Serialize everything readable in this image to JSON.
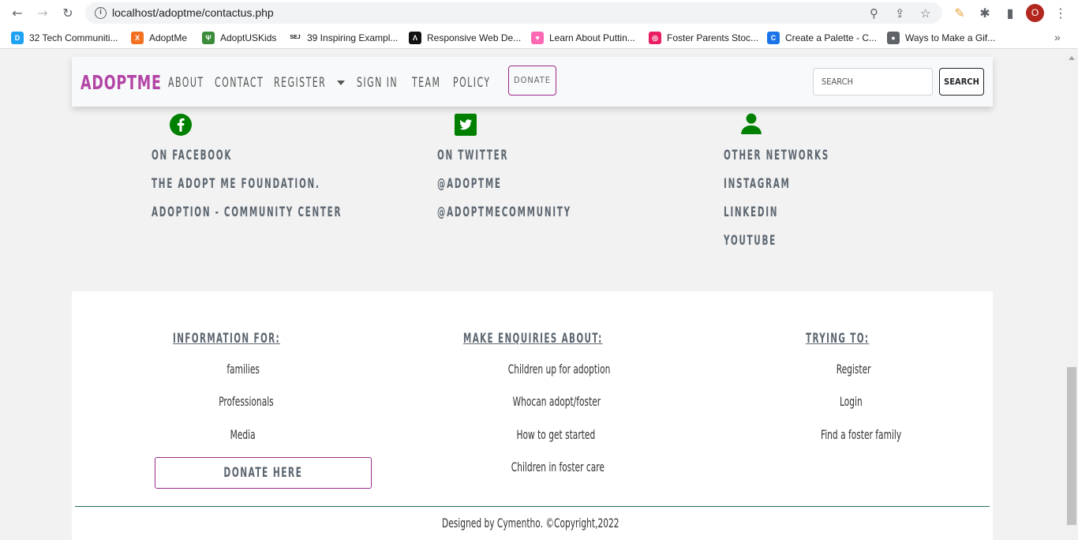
{
  "browser": {
    "url": "localhost/adoptme/contactus.php",
    "profile_initial": "O",
    "bookmarks": [
      {
        "label": "32 Tech Communiti...",
        "color": "#1da1f2",
        "glyph": "D"
      },
      {
        "label": "AdoptMe",
        "color": "#f37021",
        "glyph": "X"
      },
      {
        "label": "AdoptUSKids",
        "color": "#3b8b3b",
        "glyph": "Ψ"
      },
      {
        "label": "39 Inspiring Exampl...",
        "color": "#ffffff",
        "glyph": "SEJ"
      },
      {
        "label": "Responsive Web De...",
        "color": "#111111",
        "glyph": "Λ"
      },
      {
        "label": "Learn About Puttin...",
        "color": "#ff69b4",
        "glyph": "♥"
      },
      {
        "label": "Foster Parents Stoc...",
        "color": "#e91e63",
        "glyph": "◎"
      },
      {
        "label": "Create a Palette - C...",
        "color": "#1a73e8",
        "glyph": "C"
      },
      {
        "label": "Ways to Make a Gif...",
        "color": "#5f6368",
        "glyph": "●"
      }
    ],
    "more_label": "»"
  },
  "navbar": {
    "brand": "ADOPTME",
    "items": [
      "ABOUT",
      "CONTACT",
      "REGISTER",
      "SIGN IN",
      "TEAM",
      "POLICY"
    ],
    "donate_label": "DONATE",
    "search_placeholder": "SEARCH",
    "search_button": "SEARCH"
  },
  "social": {
    "facebook": [
      "ON FACEBOOK",
      "THE ADOPT ME FOUNDATION.",
      "ADOPTION - COMMUNITY CENTER"
    ],
    "twitter": [
      "ON TWITTER",
      "@ADOPTME",
      "@ADOPTMECOMMUNITY"
    ],
    "other": [
      "OTHER NETWORKS",
      "INSTAGRAM",
      "LINKEDIN",
      "YOUTUBE"
    ],
    "icon_color": "#008000"
  },
  "footer": {
    "col1": {
      "heading": "INFORMATION FOR:",
      "links": [
        "families",
        "Professionals",
        "Media"
      ],
      "donate_label": "DONATE HERE"
    },
    "col2": {
      "heading": "MAKE ENQUIRIES ABOUT:",
      "links": [
        "Children up for adoption",
        "Whocan adopt/foster",
        "How to get started",
        "Children in foster care"
      ]
    },
    "col3": {
      "heading": "TRYING TO:",
      "links": [
        "Register",
        "Login",
        "Find a foster family"
      ]
    },
    "copyright": "Designed by Cymentho. ©Copyright,2022"
  },
  "colors": {
    "brand": "#b345a6",
    "donate_border": "#9c2a8a",
    "divider": "#1e6f5c"
  }
}
